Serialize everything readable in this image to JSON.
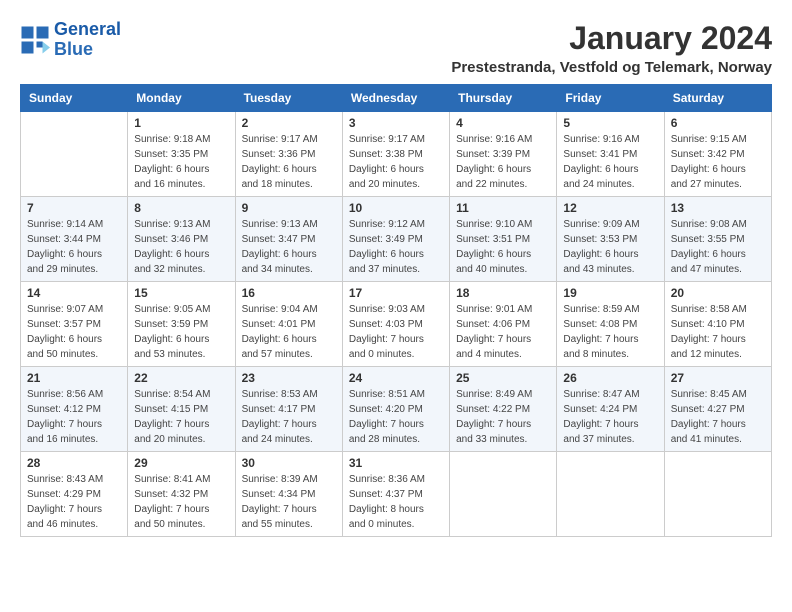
{
  "logo": {
    "text_general": "General",
    "text_blue": "Blue"
  },
  "header": {
    "title": "January 2024",
    "subtitle": "Prestestranda, Vestfold og Telemark, Norway"
  },
  "weekdays": [
    "Sunday",
    "Monday",
    "Tuesday",
    "Wednesday",
    "Thursday",
    "Friday",
    "Saturday"
  ],
  "weeks": [
    [
      {
        "day": "",
        "sunrise": "",
        "sunset": "",
        "daylight": ""
      },
      {
        "day": "1",
        "sunrise": "Sunrise: 9:18 AM",
        "sunset": "Sunset: 3:35 PM",
        "daylight": "Daylight: 6 hours and 16 minutes."
      },
      {
        "day": "2",
        "sunrise": "Sunrise: 9:17 AM",
        "sunset": "Sunset: 3:36 PM",
        "daylight": "Daylight: 6 hours and 18 minutes."
      },
      {
        "day": "3",
        "sunrise": "Sunrise: 9:17 AM",
        "sunset": "Sunset: 3:38 PM",
        "daylight": "Daylight: 6 hours and 20 minutes."
      },
      {
        "day": "4",
        "sunrise": "Sunrise: 9:16 AM",
        "sunset": "Sunset: 3:39 PM",
        "daylight": "Daylight: 6 hours and 22 minutes."
      },
      {
        "day": "5",
        "sunrise": "Sunrise: 9:16 AM",
        "sunset": "Sunset: 3:41 PM",
        "daylight": "Daylight: 6 hours and 24 minutes."
      },
      {
        "day": "6",
        "sunrise": "Sunrise: 9:15 AM",
        "sunset": "Sunset: 3:42 PM",
        "daylight": "Daylight: 6 hours and 27 minutes."
      }
    ],
    [
      {
        "day": "7",
        "sunrise": "Sunrise: 9:14 AM",
        "sunset": "Sunset: 3:44 PM",
        "daylight": "Daylight: 6 hours and 29 minutes."
      },
      {
        "day": "8",
        "sunrise": "Sunrise: 9:13 AM",
        "sunset": "Sunset: 3:46 PM",
        "daylight": "Daylight: 6 hours and 32 minutes."
      },
      {
        "day": "9",
        "sunrise": "Sunrise: 9:13 AM",
        "sunset": "Sunset: 3:47 PM",
        "daylight": "Daylight: 6 hours and 34 minutes."
      },
      {
        "day": "10",
        "sunrise": "Sunrise: 9:12 AM",
        "sunset": "Sunset: 3:49 PM",
        "daylight": "Daylight: 6 hours and 37 minutes."
      },
      {
        "day": "11",
        "sunrise": "Sunrise: 9:10 AM",
        "sunset": "Sunset: 3:51 PM",
        "daylight": "Daylight: 6 hours and 40 minutes."
      },
      {
        "day": "12",
        "sunrise": "Sunrise: 9:09 AM",
        "sunset": "Sunset: 3:53 PM",
        "daylight": "Daylight: 6 hours and 43 minutes."
      },
      {
        "day": "13",
        "sunrise": "Sunrise: 9:08 AM",
        "sunset": "Sunset: 3:55 PM",
        "daylight": "Daylight: 6 hours and 47 minutes."
      }
    ],
    [
      {
        "day": "14",
        "sunrise": "Sunrise: 9:07 AM",
        "sunset": "Sunset: 3:57 PM",
        "daylight": "Daylight: 6 hours and 50 minutes."
      },
      {
        "day": "15",
        "sunrise": "Sunrise: 9:05 AM",
        "sunset": "Sunset: 3:59 PM",
        "daylight": "Daylight: 6 hours and 53 minutes."
      },
      {
        "day": "16",
        "sunrise": "Sunrise: 9:04 AM",
        "sunset": "Sunset: 4:01 PM",
        "daylight": "Daylight: 6 hours and 57 minutes."
      },
      {
        "day": "17",
        "sunrise": "Sunrise: 9:03 AM",
        "sunset": "Sunset: 4:03 PM",
        "daylight": "Daylight: 7 hours and 0 minutes."
      },
      {
        "day": "18",
        "sunrise": "Sunrise: 9:01 AM",
        "sunset": "Sunset: 4:06 PM",
        "daylight": "Daylight: 7 hours and 4 minutes."
      },
      {
        "day": "19",
        "sunrise": "Sunrise: 8:59 AM",
        "sunset": "Sunset: 4:08 PM",
        "daylight": "Daylight: 7 hours and 8 minutes."
      },
      {
        "day": "20",
        "sunrise": "Sunrise: 8:58 AM",
        "sunset": "Sunset: 4:10 PM",
        "daylight": "Daylight: 7 hours and 12 minutes."
      }
    ],
    [
      {
        "day": "21",
        "sunrise": "Sunrise: 8:56 AM",
        "sunset": "Sunset: 4:12 PM",
        "daylight": "Daylight: 7 hours and 16 minutes."
      },
      {
        "day": "22",
        "sunrise": "Sunrise: 8:54 AM",
        "sunset": "Sunset: 4:15 PM",
        "daylight": "Daylight: 7 hours and 20 minutes."
      },
      {
        "day": "23",
        "sunrise": "Sunrise: 8:53 AM",
        "sunset": "Sunset: 4:17 PM",
        "daylight": "Daylight: 7 hours and 24 minutes."
      },
      {
        "day": "24",
        "sunrise": "Sunrise: 8:51 AM",
        "sunset": "Sunset: 4:20 PM",
        "daylight": "Daylight: 7 hours and 28 minutes."
      },
      {
        "day": "25",
        "sunrise": "Sunrise: 8:49 AM",
        "sunset": "Sunset: 4:22 PM",
        "daylight": "Daylight: 7 hours and 33 minutes."
      },
      {
        "day": "26",
        "sunrise": "Sunrise: 8:47 AM",
        "sunset": "Sunset: 4:24 PM",
        "daylight": "Daylight: 7 hours and 37 minutes."
      },
      {
        "day": "27",
        "sunrise": "Sunrise: 8:45 AM",
        "sunset": "Sunset: 4:27 PM",
        "daylight": "Daylight: 7 hours and 41 minutes."
      }
    ],
    [
      {
        "day": "28",
        "sunrise": "Sunrise: 8:43 AM",
        "sunset": "Sunset: 4:29 PM",
        "daylight": "Daylight: 7 hours and 46 minutes."
      },
      {
        "day": "29",
        "sunrise": "Sunrise: 8:41 AM",
        "sunset": "Sunset: 4:32 PM",
        "daylight": "Daylight: 7 hours and 50 minutes."
      },
      {
        "day": "30",
        "sunrise": "Sunrise: 8:39 AM",
        "sunset": "Sunset: 4:34 PM",
        "daylight": "Daylight: 7 hours and 55 minutes."
      },
      {
        "day": "31",
        "sunrise": "Sunrise: 8:36 AM",
        "sunset": "Sunset: 4:37 PM",
        "daylight": "Daylight: 8 hours and 0 minutes."
      },
      {
        "day": "",
        "sunrise": "",
        "sunset": "",
        "daylight": ""
      },
      {
        "day": "",
        "sunrise": "",
        "sunset": "",
        "daylight": ""
      },
      {
        "day": "",
        "sunrise": "",
        "sunset": "",
        "daylight": ""
      }
    ]
  ]
}
